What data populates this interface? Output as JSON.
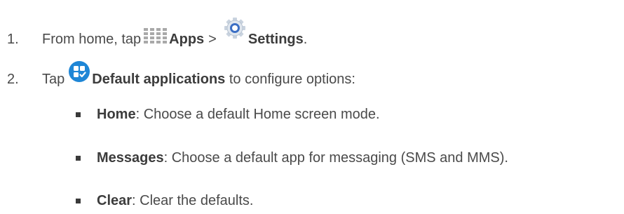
{
  "steps": [
    {
      "number": "1.",
      "text_before": "From home, tap",
      "apps_label": "Apps",
      "separator": ">",
      "settings_label": "Settings",
      "text_after": "."
    },
    {
      "number": "2.",
      "text_before": "Tap",
      "default_apps_label": "Default applications",
      "text_after": " to configure options:"
    }
  ],
  "options": [
    {
      "name": "Home",
      "description": ": Choose a default Home screen mode."
    },
    {
      "name": "Messages",
      "description": ": Choose a default app for messaging (SMS and MMS)."
    },
    {
      "name": "Clear",
      "description": ": Clear the defaults."
    }
  ],
  "icons": {
    "apps": "apps-grid-icon",
    "settings": "settings-gear-icon",
    "default_apps": "default-applications-icon"
  },
  "colors": {
    "text": "#4a4a4a",
    "default_apps_icon": "#1e86d6",
    "settings_icon": "#3b6fc4",
    "apps_icon": "#a9a9a9"
  }
}
